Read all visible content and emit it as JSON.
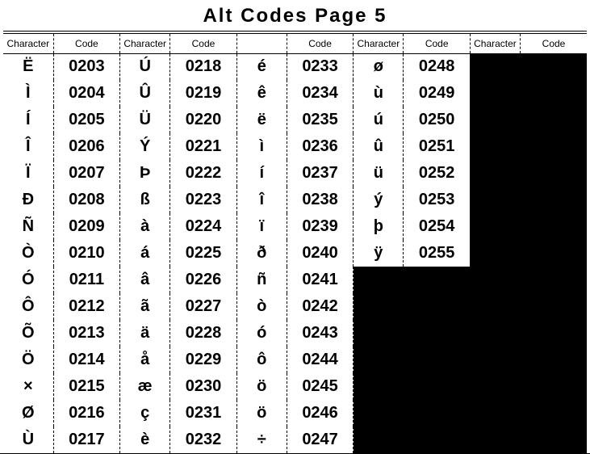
{
  "title": "Alt Codes Page 5",
  "headers": [
    "Character",
    "Code",
    "Character",
    "Code",
    "",
    "Code",
    "Character",
    "Code",
    "Character",
    "Code"
  ],
  "columns": [
    [
      {
        "char": "Ë",
        "code": "0203"
      },
      {
        "char": "Ì",
        "code": "0204"
      },
      {
        "char": "Í",
        "code": "0205"
      },
      {
        "char": "Î",
        "code": "0206"
      },
      {
        "char": "Ï",
        "code": "0207"
      },
      {
        "char": "Ð",
        "code": "0208"
      },
      {
        "char": "Ñ",
        "code": "0209"
      },
      {
        "char": "Ò",
        "code": "0210"
      },
      {
        "char": "Ó",
        "code": "0211"
      },
      {
        "char": "Ô",
        "code": "0212"
      },
      {
        "char": "Õ",
        "code": "0213"
      },
      {
        "char": "Ö",
        "code": "0214"
      },
      {
        "char": "×",
        "code": "0215"
      },
      {
        "char": "Ø",
        "code": "0216"
      },
      {
        "char": "Ù",
        "code": "0217"
      }
    ],
    [
      {
        "char": "Ú",
        "code": "0218"
      },
      {
        "char": "Û",
        "code": "0219"
      },
      {
        "char": "Ü",
        "code": "0220"
      },
      {
        "char": "Ý",
        "code": "0221"
      },
      {
        "char": "Þ",
        "code": "0222"
      },
      {
        "char": "ß",
        "code": "0223"
      },
      {
        "char": "à",
        "code": "0224"
      },
      {
        "char": "á",
        "code": "0225"
      },
      {
        "char": "â",
        "code": "0226"
      },
      {
        "char": "ã",
        "code": "0227"
      },
      {
        "char": "ä",
        "code": "0228"
      },
      {
        "char": "å",
        "code": "0229"
      },
      {
        "char": "æ",
        "code": "0230"
      },
      {
        "char": "ç",
        "code": "0231"
      },
      {
        "char": "è",
        "code": "0232"
      }
    ],
    [
      {
        "char": "é",
        "code": "0233"
      },
      {
        "char": "ê",
        "code": "0234"
      },
      {
        "char": "ë",
        "code": "0235"
      },
      {
        "char": "ì",
        "code": "0236"
      },
      {
        "char": "í",
        "code": "0237"
      },
      {
        "char": "î",
        "code": "0238"
      },
      {
        "char": "ï",
        "code": "0239"
      },
      {
        "char": "ð",
        "code": "0240"
      },
      {
        "char": "ñ",
        "code": "0241"
      },
      {
        "char": "ò",
        "code": "0242"
      },
      {
        "char": "ó",
        "code": "0243"
      },
      {
        "char": "ô",
        "code": "0244"
      },
      {
        "char": "ö",
        "code": "0245"
      },
      {
        "char": "ö",
        "code": "0246"
      },
      {
        "char": "÷",
        "code": "0247"
      }
    ],
    [
      {
        "char": "ø",
        "code": "0248"
      },
      {
        "char": "ù",
        "code": "0249"
      },
      {
        "char": "ú",
        "code": "0250"
      },
      {
        "char": "û",
        "code": "0251"
      },
      {
        "char": "ü",
        "code": "0252"
      },
      {
        "char": "ý",
        "code": "0253"
      },
      {
        "char": "þ",
        "code": "0254"
      },
      {
        "char": "ÿ",
        "code": "0255"
      }
    ],
    []
  ],
  "rows": 15
}
